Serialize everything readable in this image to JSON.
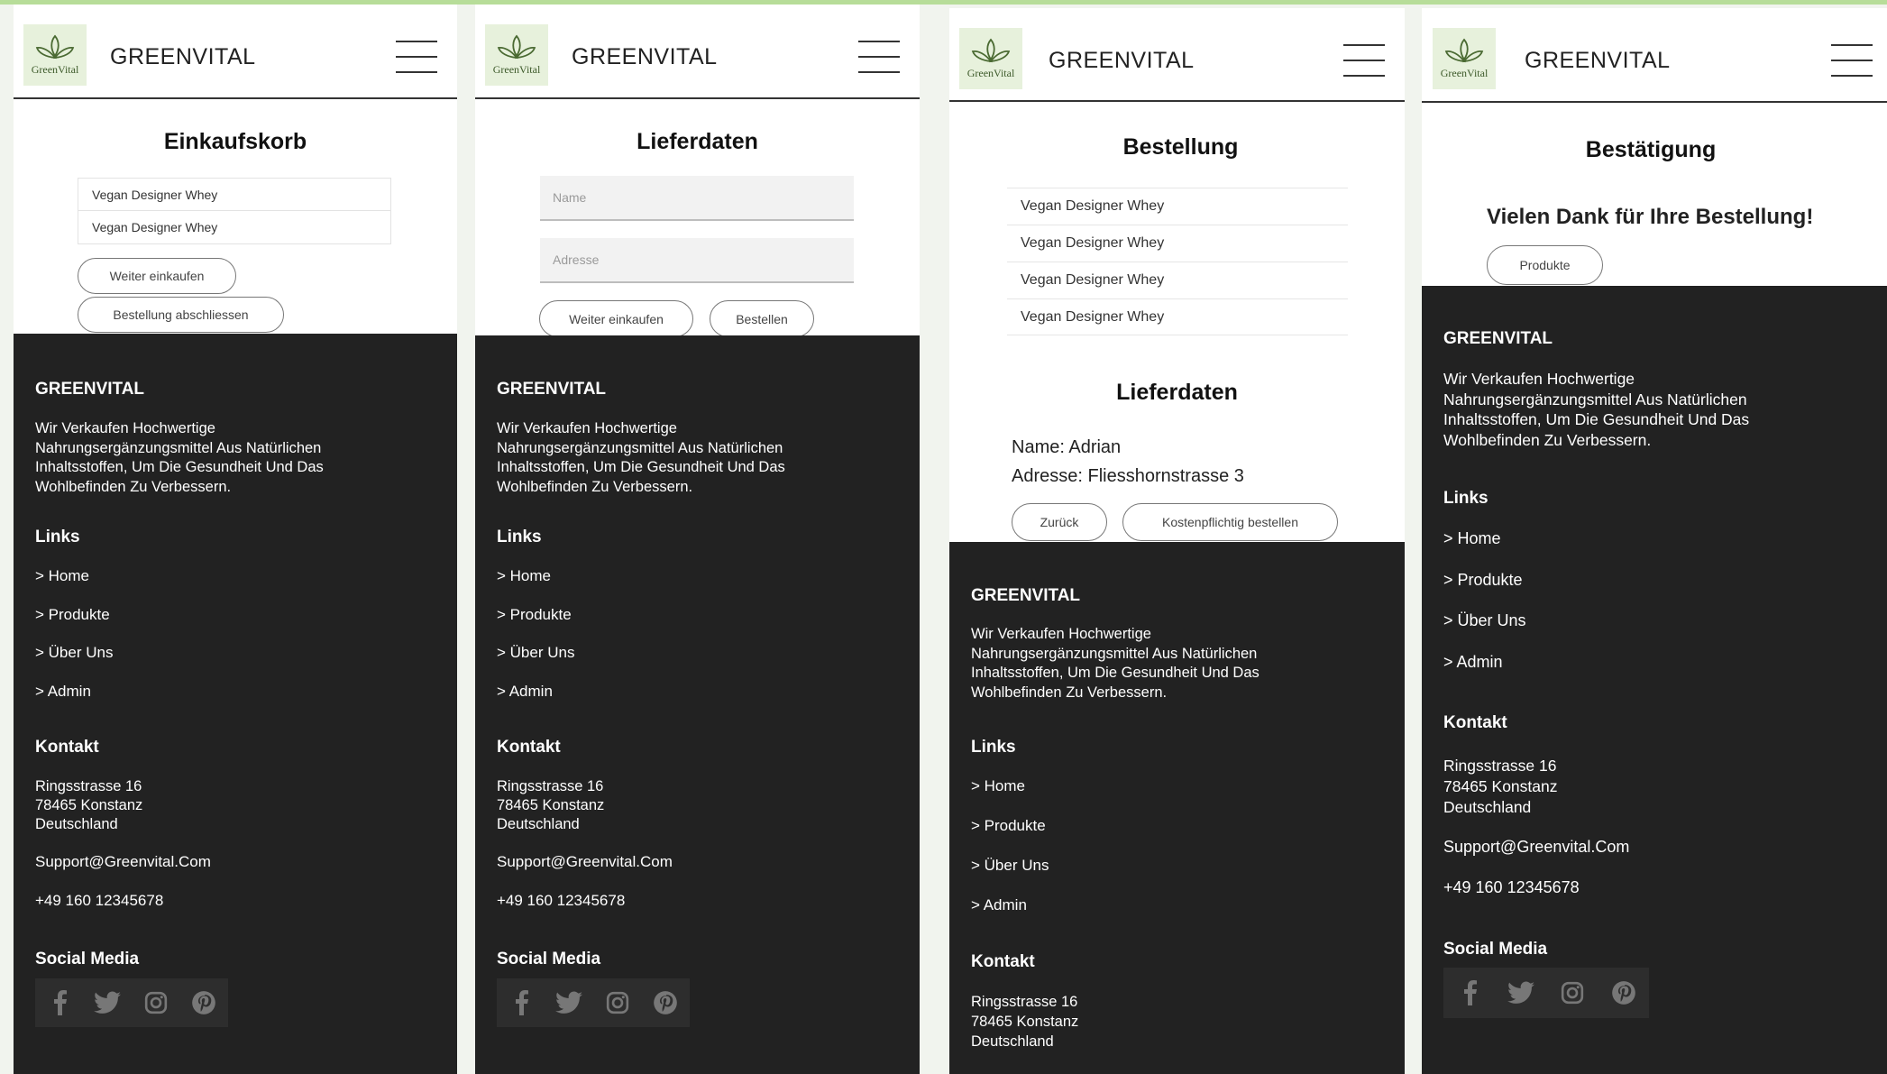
{
  "brand": {
    "name": "GREENVITAL",
    "logo_text": "GreenVital"
  },
  "cart": {
    "title": "Einkaufskorb",
    "items": [
      "Vegan Designer Whey",
      "Vegan Designer Whey"
    ],
    "continue_label": "Weiter einkaufen",
    "checkout_label": "Bestellung abschliessen"
  },
  "delivery": {
    "title": "Lieferdaten",
    "name_placeholder": "Name",
    "address_placeholder": "Adresse",
    "continue_label": "Weiter einkaufen",
    "order_label": "Bestellen"
  },
  "order": {
    "title": "Bestellung",
    "items": [
      "Vegan Designer Whey",
      "Vegan Designer Whey",
      "Vegan Designer Whey",
      "Vegan Designer Whey"
    ],
    "delivery_title": "Lieferdaten",
    "name_line": "Name: Adrian",
    "address_line": "Adresse: Fliesshornstrasse 3",
    "back_label": "Zurück",
    "pay_label": "Kostenpflichtig bestellen"
  },
  "confirm": {
    "title": "Bestätigung",
    "message": "Vielen Dank für Ihre Bestellung!",
    "products_label": "Produkte"
  },
  "footer": {
    "brand": "GREENVITAL",
    "description": "Wir Verkaufen Hochwertige Nahrungsergänzungsmittel Aus Natürlichen Inhaltsstoffen, Um Die Gesundheit Und Das Wohlbefinden Zu Verbessern.",
    "links_title": "Links",
    "links": [
      "> Home",
      "> Produkte",
      "> Über Uns",
      "> Admin"
    ],
    "contact_title": "Kontakt",
    "street": "Ringsstrasse 16",
    "city": "78465 Konstanz",
    "country": "Deutschland",
    "email": "Support@Greenvital.Com",
    "phone": "+49 160 12345678",
    "social_title": "Social Media",
    "social_icons": [
      "facebook-icon",
      "twitter-icon",
      "instagram-icon",
      "pinterest-icon"
    ]
  },
  "colors": {
    "accent": "#b7dd99",
    "footer_bg": "#222222",
    "logo_bg": "#e7f1dc",
    "background": "#f1f4ee"
  }
}
